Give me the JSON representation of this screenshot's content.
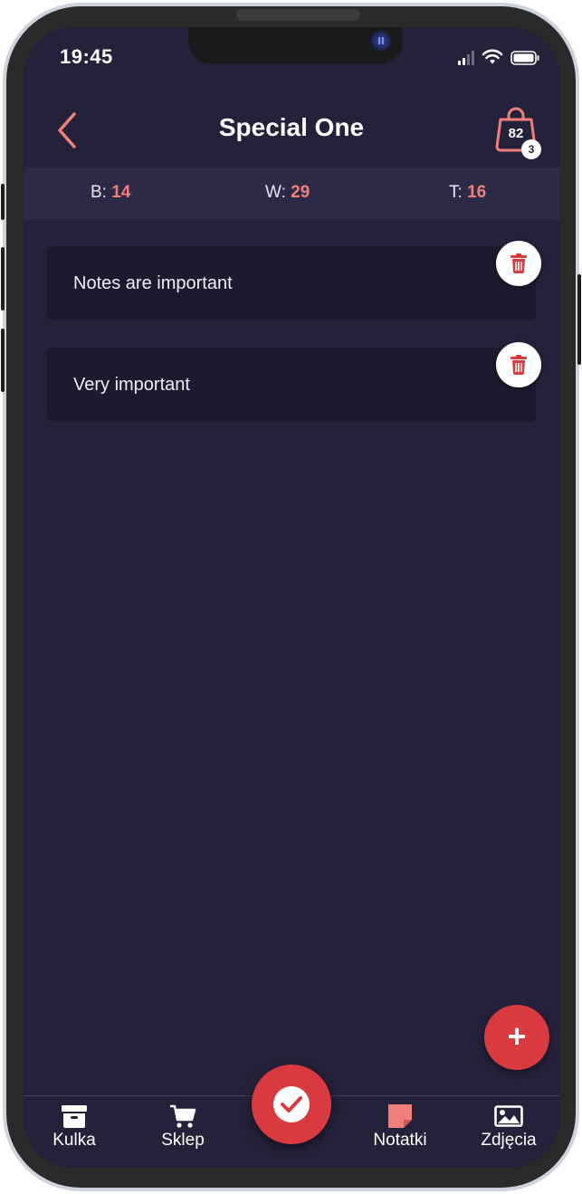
{
  "status_bar": {
    "time": "19:45",
    "icons": [
      "cellular-signal-icon",
      "wifi-icon",
      "battery-icon"
    ]
  },
  "header": {
    "title": "Special One",
    "back_icon": "chevron-left-icon",
    "bag_icon": "shopping-bag-icon",
    "bag_count": "82",
    "bag_badge": "3"
  },
  "stats": [
    {
      "label": "B:",
      "value": "14"
    },
    {
      "label": "W:",
      "value": "29"
    },
    {
      "label": "T:",
      "value": "16"
    }
  ],
  "notes": [
    {
      "text": "Notes are important",
      "action_icon": "trash-icon"
    },
    {
      "text": "Very important",
      "action_icon": "trash-icon"
    }
  ],
  "fab": {
    "label": "+",
    "icon": "plus-icon"
  },
  "tabbar": {
    "tabs": [
      {
        "label": "Kulka",
        "icon": "archive-box-icon"
      },
      {
        "label": "Sklep",
        "icon": "cart-icon"
      },
      {
        "label": "Notatki",
        "icon": "sticky-note-icon"
      },
      {
        "label": "Zdjęcia",
        "icon": "image-icon"
      }
    ],
    "center_icon": "check-circle-icon"
  },
  "colors": {
    "background": "#24213a",
    "stats_bar": "#2d2a47",
    "card": "#1c1a2e",
    "accent_red": "#d93a40",
    "accent_salmon": "#ef7f78"
  }
}
